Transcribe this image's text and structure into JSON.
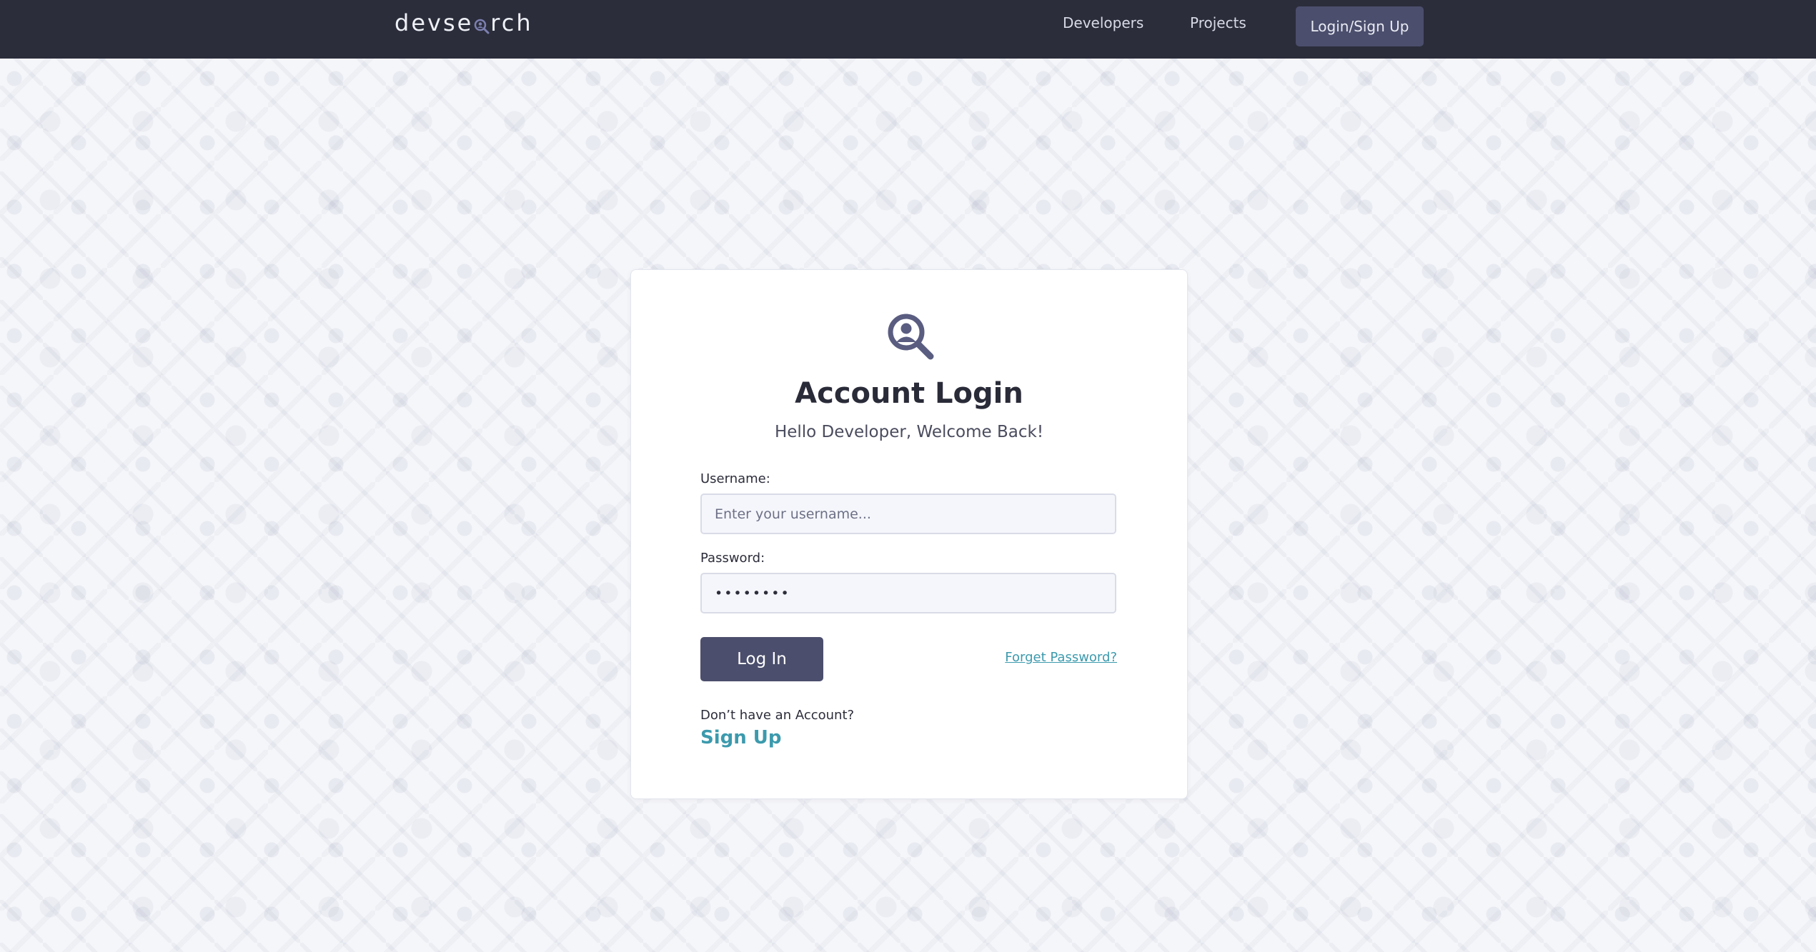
{
  "header": {
    "logo_left": "devse",
    "logo_right": "rch",
    "nav": {
      "developers": "Developers",
      "projects": "Projects",
      "login_signup": "Login/Sign Up"
    }
  },
  "login": {
    "title": "Account Login",
    "subtitle": "Hello Developer, Welcome Back!",
    "username_label": "Username:",
    "username_placeholder": "Enter your username...",
    "password_label": "Password:",
    "password_value": "••••••••",
    "login_button": "Log In",
    "forgot_password": "Forget Password?",
    "no_account_text": "Don’t have an Account?",
    "signup_link": "Sign Up"
  },
  "colors": {
    "header_bg": "#2c2d3b",
    "accent": "#4b4e6c",
    "link": "#3c9aad"
  },
  "icons": {
    "logo_mark": "search-person-icon",
    "card_icon": "search-person-icon"
  }
}
